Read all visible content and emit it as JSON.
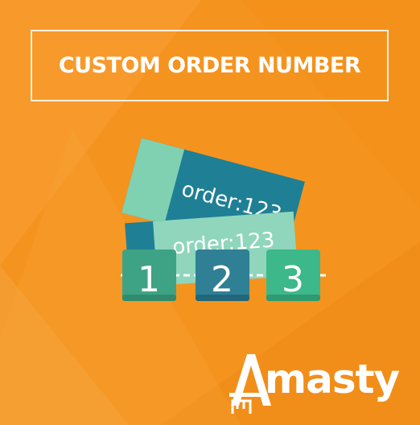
{
  "banner": {
    "title": "CUSTOM ORDER NUMBER",
    "background_color": "#f5931f"
  },
  "tickets": {
    "back_text": "order:123",
    "front_text": "order:123",
    "light_color": "#7fd1b2",
    "dark_color": "#1f7f95"
  },
  "counter": {
    "digits": [
      "1",
      "2",
      "3"
    ],
    "tile_colors": [
      "#3ea384",
      "#2f7f95",
      "#3db88a"
    ]
  },
  "brand": {
    "name": "masty",
    "logo_letter": "A"
  }
}
